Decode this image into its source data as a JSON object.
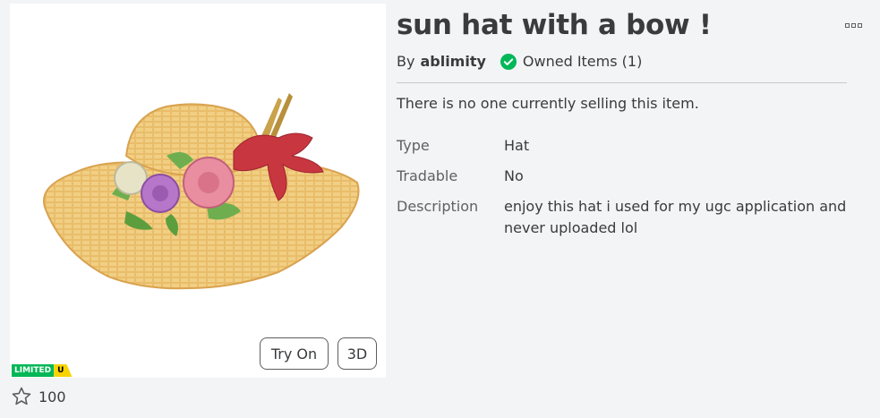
{
  "item": {
    "title": "sun hat with a bow !",
    "by_label": "By",
    "creator": "ablimity",
    "owned_text": "Owned Items (1)",
    "notice": "There is no one currently selling this item.",
    "details": {
      "type_label": "Type",
      "type_value": "Hat",
      "tradable_label": "Tradable",
      "tradable_value": "No",
      "description_label": "Description",
      "description_value": "enjoy this hat i used for my ugc application and never uploaded lol"
    }
  },
  "thumbnail": {
    "try_on_label": "Try On",
    "three_d_label": "3D",
    "limited_label": "LIMITED",
    "limited_u_label": "U"
  },
  "favorites": {
    "count": "100"
  },
  "icons": {
    "owned": "check-circle-icon",
    "favorite": "star-outline-icon",
    "more": "more-options-icon"
  },
  "colors": {
    "owned_green": "#02b757",
    "limited_green": "#02b757",
    "limited_yellow": "#f8d300",
    "background": "#f2f4f5"
  }
}
